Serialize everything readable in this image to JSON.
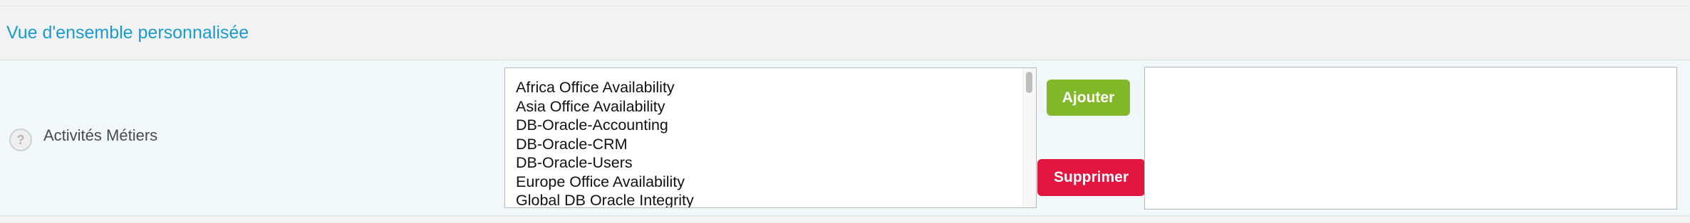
{
  "section": {
    "title": "Vue d'ensemble personnalisée"
  },
  "field": {
    "help_icon": "question-circle-icon",
    "label": "Activités Métiers",
    "available_options": [
      "Africa Office Availability",
      "Asia Office Availability",
      "DB-Oracle-Accounting",
      "DB-Oracle-CRM",
      "DB-Oracle-Users",
      "Europe Office Availability",
      "Global DB Oracle Integrity"
    ],
    "selected_options": []
  },
  "buttons": {
    "add_label": "Ajouter",
    "remove_label": "Supprimer"
  },
  "colors": {
    "title": "#1a9bd0",
    "add_button": "#84b82b",
    "remove_button": "#e1163f",
    "row_background": "#f1f8fc"
  }
}
